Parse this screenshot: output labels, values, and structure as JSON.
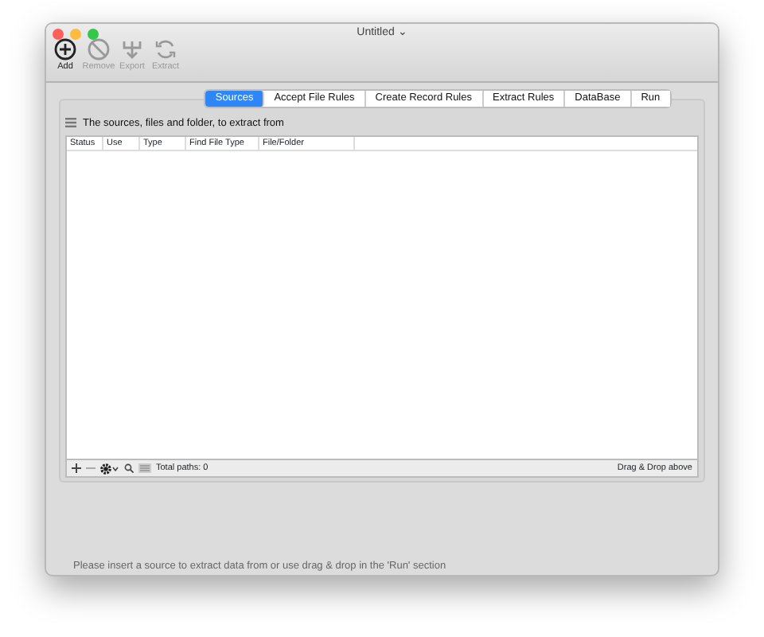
{
  "window": {
    "title": "Untitled ⌄"
  },
  "toolbar": [
    {
      "label": "Add",
      "kind": "add",
      "disabled": false
    },
    {
      "label": "Remove",
      "kind": "remove",
      "disabled": true
    },
    {
      "label": "Export",
      "kind": "export",
      "disabled": true
    },
    {
      "label": "Extract",
      "kind": "extract",
      "disabled": true
    }
  ],
  "tabs": [
    {
      "label": "Sources",
      "selected": true
    },
    {
      "label": "Accept File Rules",
      "selected": false
    },
    {
      "label": "Create Record Rules",
      "selected": false
    },
    {
      "label": "Extract Rules",
      "selected": false
    },
    {
      "label": "DataBase",
      "selected": false
    },
    {
      "label": "Run",
      "selected": false
    }
  ],
  "section_title": "The sources, files and folder, to extract from",
  "table": {
    "columns": [
      "Status",
      "Use",
      "Type",
      "Find File Type",
      "File/Folder"
    ]
  },
  "bottom_bar": {
    "total": "Total paths: 0",
    "hint": "Drag & Drop above"
  },
  "message": "Please insert a source to extract data from or use drag & drop in the 'Run' section"
}
